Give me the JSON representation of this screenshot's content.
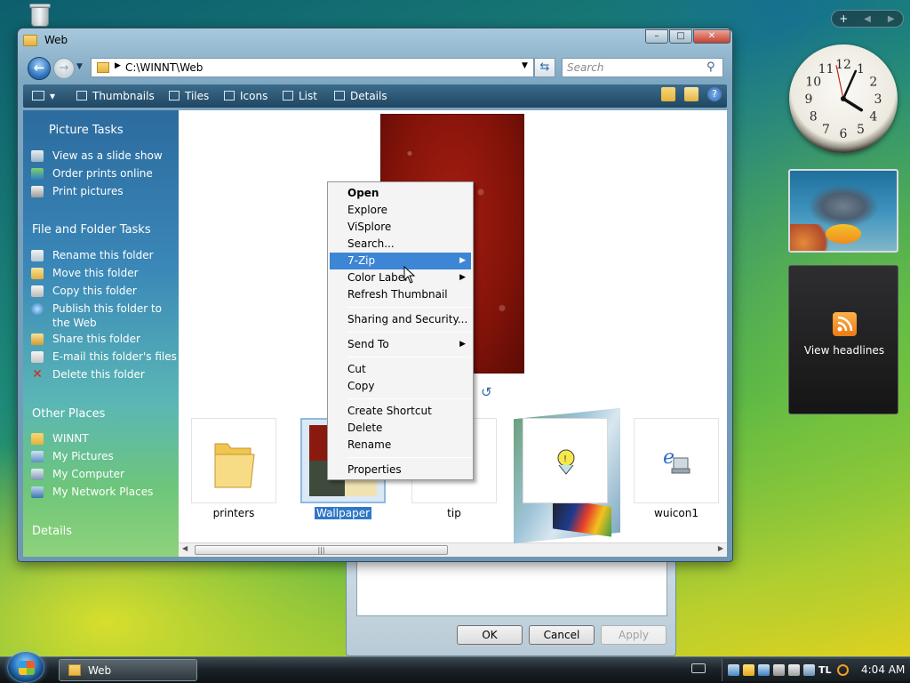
{
  "window": {
    "title": "Web",
    "address": "C:\\WINNT\\Web",
    "search_placeholder": "Search"
  },
  "toolbar": {
    "items": [
      "Thumbnails",
      "Tiles",
      "Icons",
      "List",
      "Details"
    ]
  },
  "taskpane": {
    "picture_tasks": {
      "heading": "Picture Tasks",
      "items": [
        "View as a slide show",
        "Order prints online",
        "Print pictures"
      ]
    },
    "file_folder_tasks": {
      "heading": "File and Folder Tasks",
      "items": [
        "Rename this folder",
        "Move this folder",
        "Copy this folder",
        "Publish this folder to the Web",
        "Share this folder",
        "E-mail this folder's files",
        "Delete this folder"
      ]
    },
    "other_places": {
      "heading": "Other Places",
      "items": [
        "WINNT",
        "My Pictures",
        "My Computer",
        "My Network Places"
      ]
    },
    "details": {
      "heading": "Details"
    }
  },
  "files": [
    {
      "name": "printers",
      "selected": false
    },
    {
      "name": "Wallpaper",
      "selected": true
    },
    {
      "name": "tip",
      "selected": false
    },
    {
      "name": "wuicon1",
      "selected": false
    }
  ],
  "context_menu": {
    "items": [
      {
        "label": "Open",
        "bold": true
      },
      {
        "label": "Explore"
      },
      {
        "label": "ViSplore"
      },
      {
        "label": "Search..."
      },
      {
        "label": "7-Zip",
        "submenu": true,
        "highlighted": true
      },
      {
        "label": "Color Label",
        "submenu": true
      },
      {
        "label": "Refresh Thumbnail"
      },
      {
        "label": "Sharing and Security..."
      },
      {
        "label": "Send To",
        "submenu": true
      },
      {
        "label": "Cut"
      },
      {
        "label": "Copy"
      },
      {
        "label": "Create Shortcut"
      },
      {
        "label": "Delete"
      },
      {
        "label": "Rename"
      },
      {
        "label": "Properties"
      }
    ]
  },
  "dialog": {
    "ok": "OK",
    "cancel": "Cancel",
    "apply": "Apply"
  },
  "sidebar": {
    "clock": {
      "hour": 4,
      "minute": 4,
      "second": 58
    },
    "feed_label": "View headlines"
  },
  "taskbar": {
    "window_button": "Web",
    "clock": "4:04 AM"
  },
  "colors": {
    "selection": "#3d86d6",
    "taskpane_top": "#2c6b9e",
    "taskpane_bottom": "#8fd27b"
  }
}
